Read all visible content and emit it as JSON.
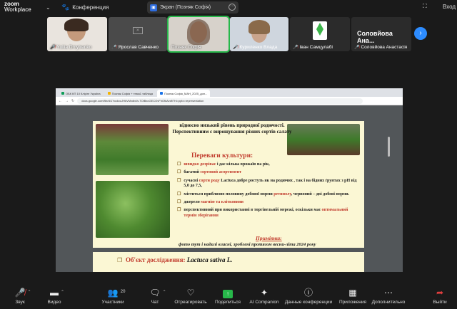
{
  "app": {
    "brand_top": "zoom",
    "brand_bottom": "Workplace",
    "meeting_label": "Конференция",
    "share_title": "Экран (Позняк Софія)",
    "exit_label": "Вход"
  },
  "participants": [
    {
      "name": "Yuliia Dmytrenko",
      "muted": true
    },
    {
      "name": "Ярослав Савченко",
      "muted": true
    },
    {
      "name": "Позняк Софія",
      "muted": false,
      "speaking": true
    },
    {
      "name": "Куриленко Влада",
      "muted": true
    },
    {
      "name": "Іван Самцулабі",
      "muted": true
    },
    {
      "name": "Соловйова Анастасія",
      "muted": true,
      "display_big": "Соловйова Ана..."
    }
  ],
  "browser": {
    "tabs": [
      "ОБК КП 10 Клірінг Україна",
      "Позняк Софія + тема1 таблиця",
      "Позняк Софія_МАН_2025_доп..."
    ],
    "url": "docs.google.com/file/d/1YockxoJHkVMxdb4h-TOlBxoGECOvFhGfkAvdf/?hl=pptx=representation"
  },
  "slide": {
    "intro": "відносно низький рівень природної родючості. Перспективним є вирощування різних сортів салату",
    "heading": "Переваги культури:",
    "advantages": [
      {
        "pre": "",
        "hl": "швидко дозріває",
        "post": " і дає кілька врожаїв на рік,"
      },
      {
        "pre": "багатий ",
        "hl": "сортовий асортимент",
        "post": ""
      },
      {
        "pre": "сучасні ",
        "hl": "сорти роду",
        "post": " Lactuca добре ростуть як на родючих , так і на бідних ґрунтах з pH від 5,0 до 7,5,"
      },
      {
        "pre": "міститься приблизно половину добової норми ",
        "hl": "ретинолу",
        "post": ", червоний – дві добові норми."
      },
      {
        "pre": "джерело ",
        "hl": "магнію та клітковини",
        "post": ""
      },
      {
        "pre": "перспективний при використанні в торгівельній мережі, оскільки має ",
        "hl": "оптимальний термін зберігання",
        "post": ""
      }
    ],
    "note_heading": "Примітка:",
    "note_body": "фото тут і надалі власні, зроблені протягом весни-літа 2024 року",
    "object_label": "Об'єкт дослідження: ",
    "object_latin": "Lactuca sativa L."
  },
  "toolbar": {
    "audio": "Звук",
    "video": "Видео",
    "participants": "Участники",
    "participants_count": "20",
    "chat": "Чат",
    "react": "Отреагировать",
    "share": "Поделиться",
    "ai": "AI Companion",
    "summary": "Данные конференции",
    "apps": "Приложения",
    "more": "Дополнительно",
    "leave": "Выйти"
  },
  "colors": {
    "accent_blue": "#2d8cff",
    "active_green": "#27b84a",
    "muted_red": "#e03e3e",
    "slide_bg": "#fbf7d4",
    "slide_highlight": "#c0392b"
  }
}
